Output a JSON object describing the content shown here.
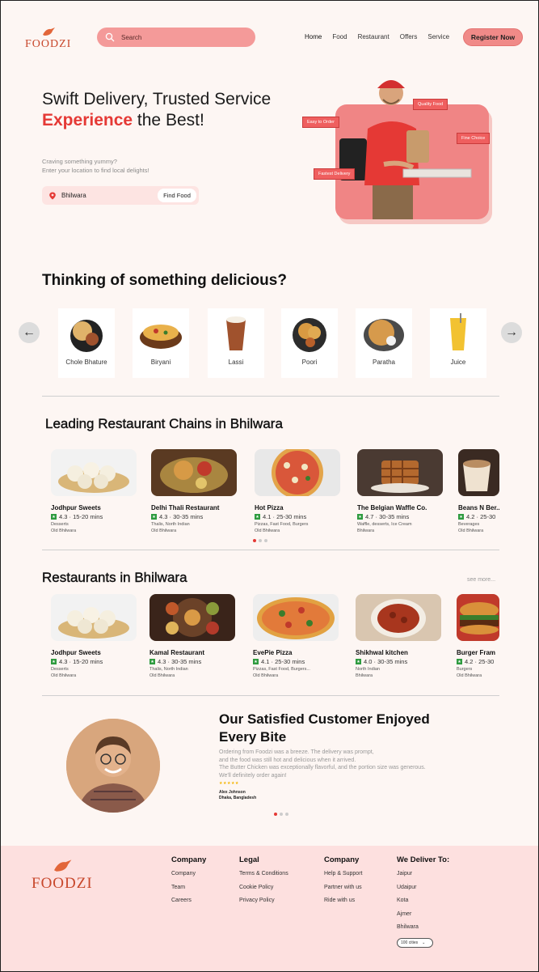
{
  "brand": {
    "name": "FOODZI"
  },
  "header": {
    "search_placeholder": "Search",
    "nav": [
      "Home",
      "Food",
      "Restaurant",
      "Offers",
      "Service"
    ],
    "register_label": "Register Now"
  },
  "hero": {
    "title_line1": "Swift Delivery, Trusted Service",
    "title_accent": "Experience",
    "title_rest": " the Best!",
    "subtitle_line1": "Craving something yummy?",
    "subtitle_line2": "Enter your location to find local delights!",
    "location_value": "Bhilwara",
    "find_label": "Find Food",
    "tags": [
      "Easy to Order",
      "Quality Food",
      "Fine Choice",
      "Fastest Delivery"
    ]
  },
  "categories": {
    "heading": "Thinking of something delicious?",
    "items": [
      "Chole Bhature",
      "Biryani",
      "Lassi",
      "Poori",
      "Paratha",
      "Juice"
    ]
  },
  "chains": {
    "heading": "Leading Restaurant Chains in Bhilwara",
    "items": [
      {
        "name": "Jodhpur Sweets",
        "rating": "4.3",
        "time": "15-20 mins",
        "cuisine": "Desserts",
        "location": "Old Bhilwara"
      },
      {
        "name": "Delhi Thali Restaurant",
        "rating": "4.3",
        "time": "30-35 mins",
        "cuisine": "Thalis, North Indian",
        "location": "Old Bhilwara"
      },
      {
        "name": "Hot Pizza",
        "rating": "4.1",
        "time": "25-30 mins",
        "cuisine": "Pizzas, Fast Food, Burgers",
        "location": "Old Bhilwara"
      },
      {
        "name": "The Belgian Waffle Co.",
        "rating": "4.7",
        "time": "30-35 mins",
        "cuisine": "Waffle, desserts, Ice Cream",
        "location": "Bhilwara"
      },
      {
        "name": "Beans N Ber..",
        "rating": "4.2",
        "time": "25-30",
        "cuisine": "Beverages",
        "location": "Old Bhilwara"
      }
    ]
  },
  "restaurants": {
    "heading": "Restaurants in Bhilwara",
    "see_more": "see more...",
    "items": [
      {
        "name": "Jodhpur Sweets",
        "rating": "4.3",
        "time": "15-20 mins",
        "cuisine": "Desserts",
        "location": "Old Bhilwara"
      },
      {
        "name": "Kamal Restaurant",
        "rating": "4.3",
        "time": "30-35 mins",
        "cuisine": "Thalis, North Indian",
        "location": "Old Bhilwara"
      },
      {
        "name": "EvePie Pizza",
        "rating": "4.1",
        "time": "25-30 mins",
        "cuisine": "Pizzas, Fast Food, Burgers...",
        "location": "Old Bhilwara"
      },
      {
        "name": "Shikhwal kitchen",
        "rating": "4.0",
        "time": "30-35 mins",
        "cuisine": "North Indian",
        "location": "Bhilwara"
      },
      {
        "name": "Burger Fram",
        "rating": "4.2",
        "time": "25-30",
        "cuisine": "Burgers",
        "location": "Old Bhilwara"
      }
    ]
  },
  "testimonial": {
    "title_line1": "Our Satisfied Customer Enjoyed",
    "title_line2": "Every Bite",
    "quote_line1": "Ordering from Foodzi was a breeze. The delivery was prompt,",
    "quote_line2": "and the food was still hot and delicious when it arrived.",
    "quote_line3": "The Butter Chicken was exceptionally flavorful, and the portion size was generous.",
    "quote_line4": "We'll definitely order again!",
    "stars": "★★★★★",
    "author": "Alex Johnson",
    "author_location": "Dhaka, Bangladesh"
  },
  "footer": {
    "col1": {
      "heading": "Company",
      "links": [
        "Company",
        "Team",
        "Careers"
      ]
    },
    "col2": {
      "heading": "Legal",
      "links": [
        "Terms & Conditions",
        "Cookie Policy",
        "Privacy Policy"
      ]
    },
    "col3": {
      "heading": "Company",
      "links": [
        "Help & Support",
        "Partner with us",
        "Ride with us"
      ]
    },
    "col4": {
      "heading": "We Deliver To:",
      "links": [
        "Jaipur",
        "Udaipur",
        "Kota",
        "Ajmer",
        "Bhilwara"
      ]
    },
    "city_select": "100 cities"
  },
  "colors": {
    "accent": "#e53935",
    "pink": "#f08a88",
    "background": "#fdf6f3",
    "footer": "#fde0df"
  }
}
